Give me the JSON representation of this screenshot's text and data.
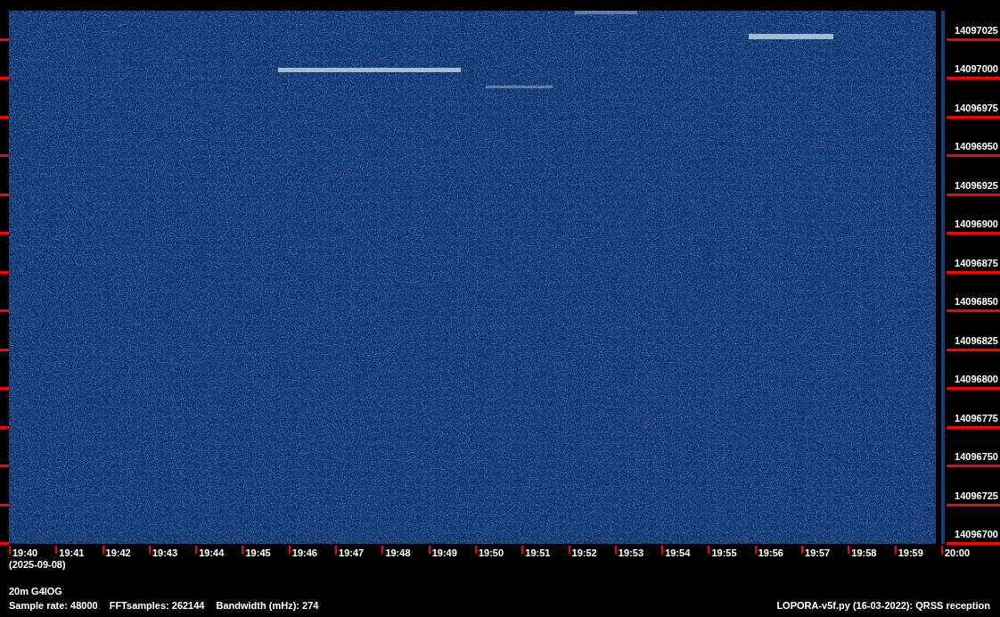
{
  "frequency_axis": {
    "labels": [
      "14097025",
      "14097000",
      "14096975",
      "14096950",
      "14096925",
      "14096900",
      "14096875",
      "14096850",
      "14096825",
      "14096800",
      "14096775",
      "14096750",
      "14096725",
      "14096700"
    ]
  },
  "time_axis": {
    "labels": [
      "19:40",
      "19:41",
      "19:42",
      "19:43",
      "19:44",
      "19:45",
      "19:46",
      "19:47",
      "19:48",
      "19:49",
      "19:50",
      "19:51",
      "19:52",
      "19:53",
      "19:54",
      "19:55",
      "19:56",
      "19:57",
      "19:58",
      "19:59",
      "20:00"
    ],
    "date": "(2025-09-08)"
  },
  "footer": {
    "station": "20m G4IOG",
    "settings": [
      "Sample rate: 48000",
      "FFTsamples: 262144",
      "Bandwidth (mHz): 274"
    ],
    "program": "LOPORA-v5f.py (16-03-2022): QRSS reception"
  }
}
